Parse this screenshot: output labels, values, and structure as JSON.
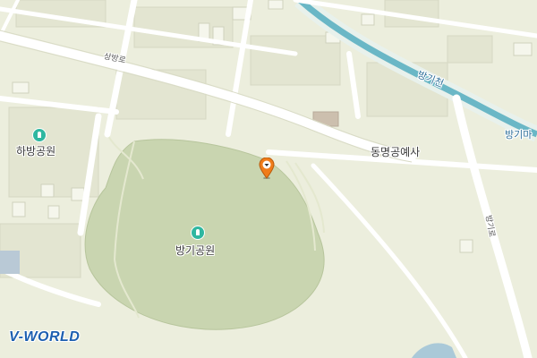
{
  "map": {
    "colors": {
      "background": "#eceedd",
      "park": "#c9d5b0",
      "road": "#ffffff",
      "stream": "#6ab7c6",
      "building": "#e2e4d2",
      "marker": "#f07c1a"
    },
    "labels": {
      "sangbang_ro": "상방로",
      "habang_park": "하방공원",
      "banggi_park": "방기공원",
      "donmyeong": "동명공예사",
      "banggicheon": "방기천",
      "banggima": "방기마",
      "banggi_ro": "방기로"
    },
    "logo": "V-WORLD",
    "marker_icon": "location-pin-icon",
    "park_icon": "park-icon"
  }
}
